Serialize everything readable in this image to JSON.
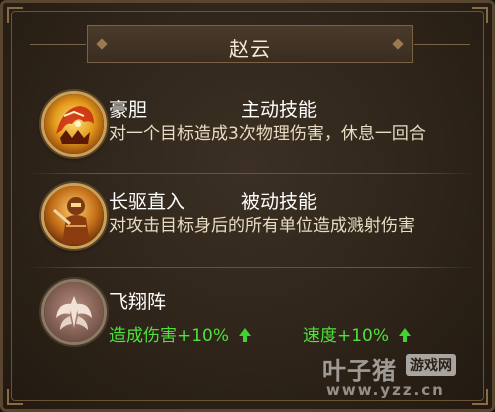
{
  "hero": {
    "name": "赵云"
  },
  "skills": [
    {
      "name": "豪胆",
      "type": "主动技能",
      "description": "对一个目标造成3次物理伤害，休息一回合",
      "icon": "mask-icon"
    },
    {
      "name": "长驱直入",
      "type": "被动技能",
      "description": "对攻击目标身后的所有单位造成溅射伤害",
      "icon": "warrior-icon"
    }
  ],
  "formation": {
    "name": "飞翔阵",
    "icon": "wing-emblem-icon",
    "bonuses": [
      {
        "label": "造成伤害+10%"
      },
      {
        "label": "速度+10%"
      }
    ]
  },
  "watermark": {
    "brand": "叶子猪",
    "badge": "游戏网",
    "url": "www.yzz.cn"
  },
  "colors": {
    "bonus_green": "#4ee23c",
    "gold_border": "#c9a25a",
    "panel_bg": "#2e2419"
  }
}
